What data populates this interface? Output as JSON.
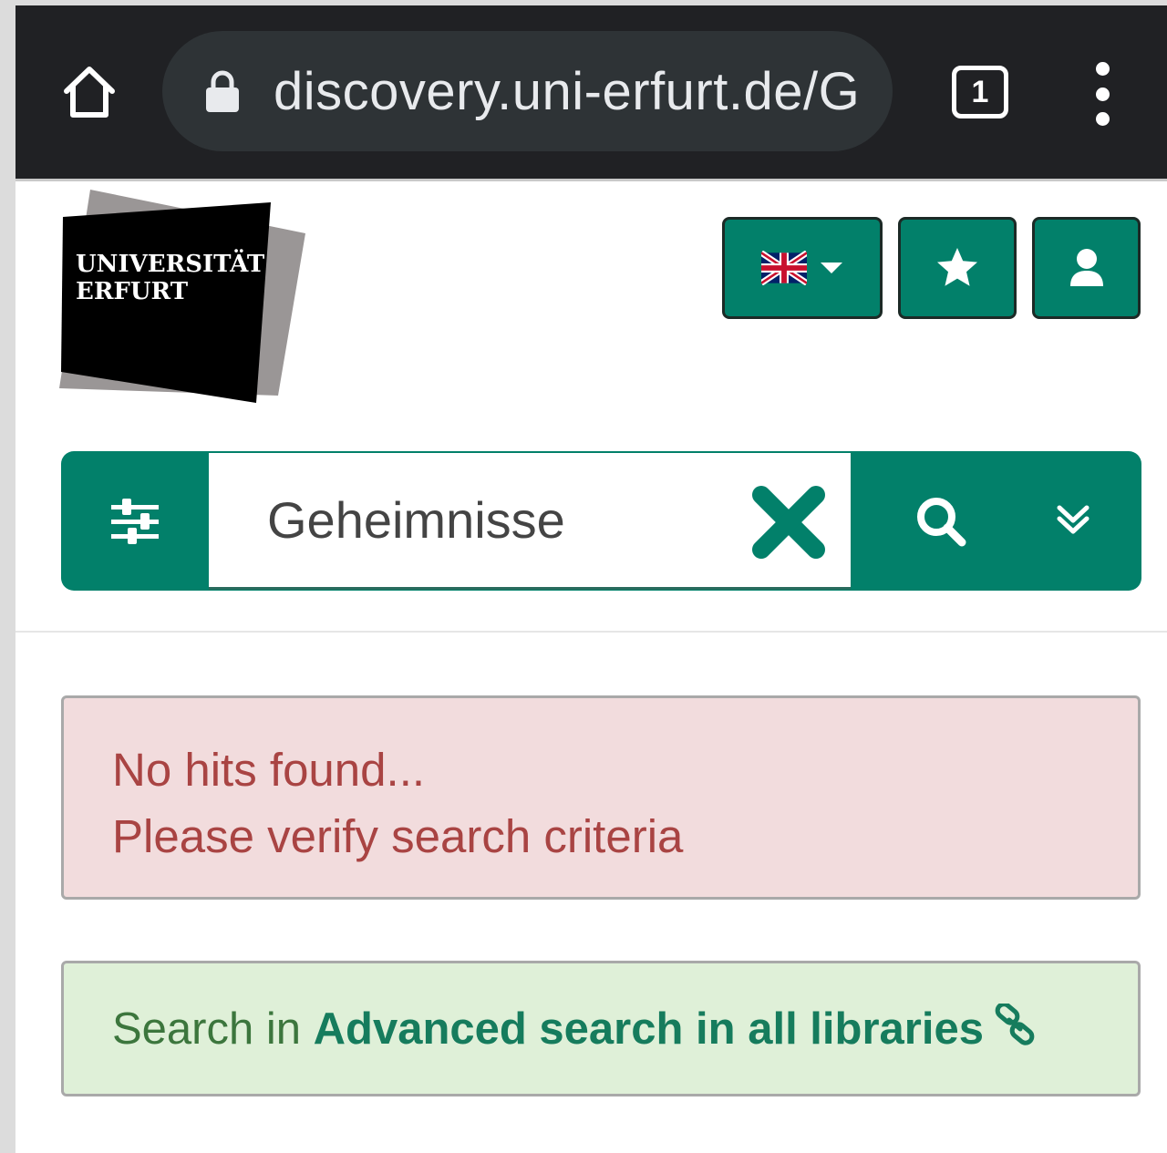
{
  "browser": {
    "url": "discovery.uni-erfurt.de/G",
    "tab_count": "1"
  },
  "logo": {
    "line1": "UNIVERSITÄT",
    "line2": "ERFURT"
  },
  "search": {
    "query": "Geheimnisse"
  },
  "alerts": {
    "no_hits": "No hits found...",
    "verify": "Please verify search criteria",
    "search_in_prefix": "Search in ",
    "search_in_link": "Advanced search in all libraries"
  },
  "colors": {
    "primary": "#02806a",
    "browser_bar": "#202124",
    "danger_bg": "#f2dcdd",
    "danger_text": "#a94443",
    "success_bg": "#dff0d8",
    "success_text": "#3c763d"
  }
}
